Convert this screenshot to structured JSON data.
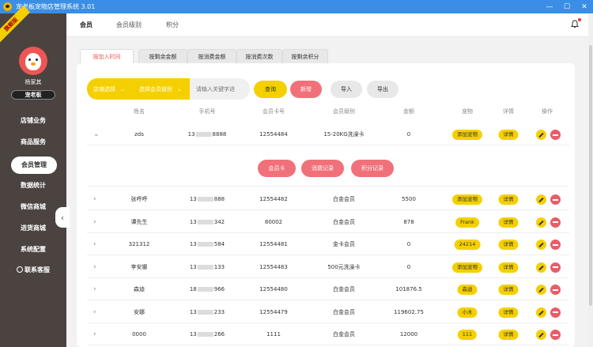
{
  "window": {
    "title": "宠老板宠物店管理系统 3.01",
    "controls": [
      "—",
      "☐",
      "✕"
    ]
  },
  "sidebar": {
    "ribbon": "旗舰版",
    "username": "杨家其",
    "role": "宠老板",
    "items": [
      {
        "label": "店铺业务",
        "active": false
      },
      {
        "label": "商品服务",
        "active": false
      },
      {
        "label": "会员管理",
        "active": true
      },
      {
        "label": "数据统计",
        "active": false
      },
      {
        "label": "微信商城",
        "active": false
      },
      {
        "label": "进货商城",
        "active": false
      },
      {
        "label": "系统配置",
        "active": false
      },
      {
        "label": "联系客服",
        "active": false
      }
    ],
    "collapse": "‹"
  },
  "topbar": {
    "tabs": [
      {
        "label": "会员",
        "active": true
      },
      {
        "label": "会员级别",
        "active": false
      },
      {
        "label": "积分",
        "active": false
      }
    ]
  },
  "subtabs": [
    {
      "label": "按加入时间",
      "active": true
    },
    {
      "label": "按剩余金额",
      "active": false
    },
    {
      "label": "按消费金额",
      "active": false
    },
    {
      "label": "按消费次数",
      "active": false
    },
    {
      "label": "按剩余积分",
      "active": false
    }
  ],
  "filters": {
    "store_select": "店铺选择",
    "level_select": "选择会员级别",
    "search_placeholder": "请输入关键字进",
    "query": "查询",
    "add": "新增",
    "import": "导入",
    "export": "导出"
  },
  "table": {
    "headers": [
      "姓名",
      "手机号",
      "会员卡号",
      "会员级别",
      "金额",
      "宠物",
      "详情",
      "操作"
    ],
    "detail_label": "详情",
    "expanded_row": {
      "caret": "⌄",
      "name": "zds",
      "phone_prefix": "13",
      "phone_suffix": "8888",
      "card": "12554484",
      "level": "15-20KG洗澡卡",
      "amount": "0",
      "pet": "添加宠物"
    },
    "expand_buttons": [
      "会员卡",
      "消费记录",
      "积分记录"
    ],
    "rows": [
      {
        "name": "张呼呼",
        "phone_prefix": "13",
        "phone_suffix": "888",
        "card": "12554482",
        "level": "白金会员",
        "amount": "5500",
        "pet": "添加宠物"
      },
      {
        "name": "谭先生",
        "phone_prefix": "13",
        "phone_suffix": "342",
        "card": "80002",
        "level": "白金会员",
        "amount": "878",
        "pet": "Frank"
      },
      {
        "name": "321312",
        "phone_prefix": "13",
        "phone_suffix": "584",
        "card": "12554481",
        "level": "金卡会员",
        "amount": "0",
        "pet": "24214"
      },
      {
        "name": "李安娜",
        "phone_prefix": "13",
        "phone_suffix": "133",
        "card": "12554483",
        "level": "500元洗澡卡",
        "amount": "0",
        "pet": "添加宠物"
      },
      {
        "name": "森迪",
        "phone_prefix": "18",
        "phone_suffix": "966",
        "card": "12554480",
        "level": "白金会员",
        "amount": "101876.5",
        "pet": "森迪"
      },
      {
        "name": "安娜",
        "phone_prefix": "13",
        "phone_suffix": "233",
        "card": "12554479",
        "level": "白金会员",
        "amount": "119602.75",
        "pet": "小木"
      },
      {
        "name": "0000",
        "phone_prefix": "13",
        "phone_suffix": "266",
        "card": "1111",
        "level": "白金会员",
        "amount": "12000",
        "pet": "111"
      }
    ],
    "row_caret": "›"
  },
  "colors": {
    "titlebar": "#3a8ee6",
    "sidebar": "#4a4340",
    "accent_yellow": "#f5d000",
    "accent_red": "#f1717a"
  }
}
